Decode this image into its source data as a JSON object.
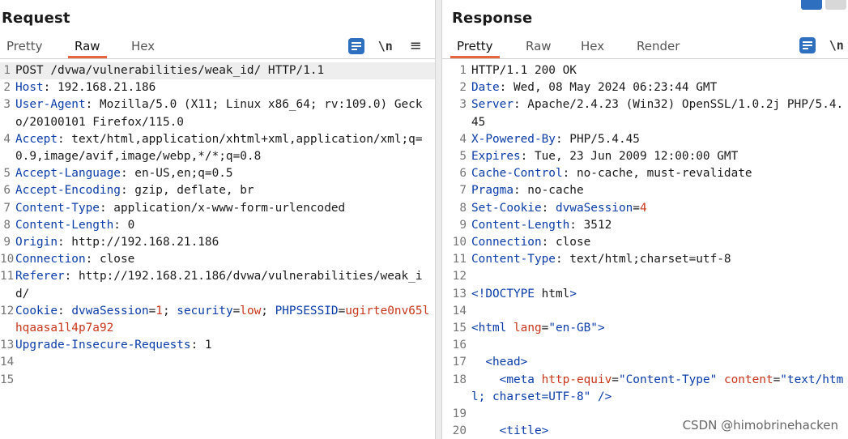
{
  "request": {
    "title": "Request",
    "tabs": [
      "Pretty",
      "Raw",
      "Hex"
    ],
    "active_tab": "Raw",
    "tools": {
      "newline": "\\n",
      "menu": "≡"
    }
  },
  "response": {
    "title": "Response",
    "tabs": [
      "Pretty",
      "Raw",
      "Hex",
      "Render"
    ],
    "active_tab": "Pretty",
    "tools": {
      "newline": "\\n"
    }
  },
  "request_lines": [
    {
      "n": "1",
      "t": "POST /dvwa/vulnerabilities/weak_id/ HTTP/1.1"
    },
    {
      "n": "2",
      "k": "Host",
      "t": ": 192.168.21.186"
    },
    {
      "n": "3",
      "k": "User-Agent",
      "t": ": Mozilla/5.0 (X11; Linux x86_64; rv:109.0) Gecko/20100101 Firefox/115.0"
    },
    {
      "n": "4",
      "k": "Accept",
      "t": ": text/html,application/xhtml+xml,application/xml;q=0.9,image/avif,image/webp,*/*;q=0.8"
    },
    {
      "n": "5",
      "k": "Accept-Language",
      "t": ": en-US,en;q=0.5"
    },
    {
      "n": "6",
      "k": "Accept-Encoding",
      "t": ": gzip, deflate, br"
    },
    {
      "n": "7",
      "k": "Content-Type",
      "t": ": application/x-www-form-urlencoded"
    },
    {
      "n": "8",
      "k": "Content-Length",
      "t": ": 0"
    },
    {
      "n": "9",
      "k": "Origin",
      "t": ": http://192.168.21.186"
    },
    {
      "n": "10",
      "k": "Connection",
      "t": ": close"
    },
    {
      "n": "11",
      "k": "Referer",
      "t": ": http://192.168.21.186/dvwa/vulnerabilities/weak_id/"
    },
    {
      "n": "12",
      "cookie": {
        "name": "Cookie",
        "parts": [
          [
            "dvwaSession",
            "1"
          ],
          [
            "security",
            "low"
          ],
          [
            "PHPSESSID",
            "ugirte0nv65lhqaasa1l4p7a92"
          ]
        ]
      }
    },
    {
      "n": "13",
      "k": "Upgrade-Insecure-Requests",
      "t": ": 1"
    },
    {
      "n": "14",
      "t": ""
    },
    {
      "n": "15",
      "t": ""
    }
  ],
  "response_lines": [
    {
      "n": "1",
      "t": "HTTP/1.1 200 OK"
    },
    {
      "n": "2",
      "k": "Date",
      "t": ": Wed, 08 May 2024 06:23:44 GMT"
    },
    {
      "n": "3",
      "k": "Server",
      "t": ": Apache/2.4.23 (Win32) OpenSSL/1.0.2j PHP/5.4.45"
    },
    {
      "n": "4",
      "k": "X-Powered-By",
      "t": ": PHP/5.4.45"
    },
    {
      "n": "5",
      "k": "Expires",
      "t": ": Tue, 23 Jun 2009 12:00:00 GMT"
    },
    {
      "n": "6",
      "k": "Cache-Control",
      "t": ": no-cache, must-revalidate"
    },
    {
      "n": "7",
      "k": "Pragma",
      "t": ": no-cache"
    },
    {
      "n": "8",
      "setcookie": {
        "name": "Set-Cookie",
        "ck": "dvwaSession",
        "cv": "4"
      }
    },
    {
      "n": "9",
      "k": "Content-Length",
      "t": ": 3512"
    },
    {
      "n": "10",
      "k": "Connection",
      "t": ": close"
    },
    {
      "n": "11",
      "k": "Content-Type",
      "t": ": text/html;charset=utf-8"
    },
    {
      "n": "12",
      "t": ""
    },
    {
      "n": "13",
      "html": "<!DOCTYPE html>"
    },
    {
      "n": "14",
      "t": ""
    },
    {
      "n": "15",
      "html": "<html lang=\"en-GB\">"
    },
    {
      "n": "16",
      "t": ""
    },
    {
      "n": "17",
      "html": "  <head>"
    },
    {
      "n": "18",
      "html": "    <meta http-equiv=\"Content-Type\" content=\"text/html; charset=UTF-8\" />"
    },
    {
      "n": "19",
      "t": ""
    },
    {
      "n": "20",
      "html": "    <title>"
    }
  ],
  "watermark": "CSDN @himobrinehacken"
}
